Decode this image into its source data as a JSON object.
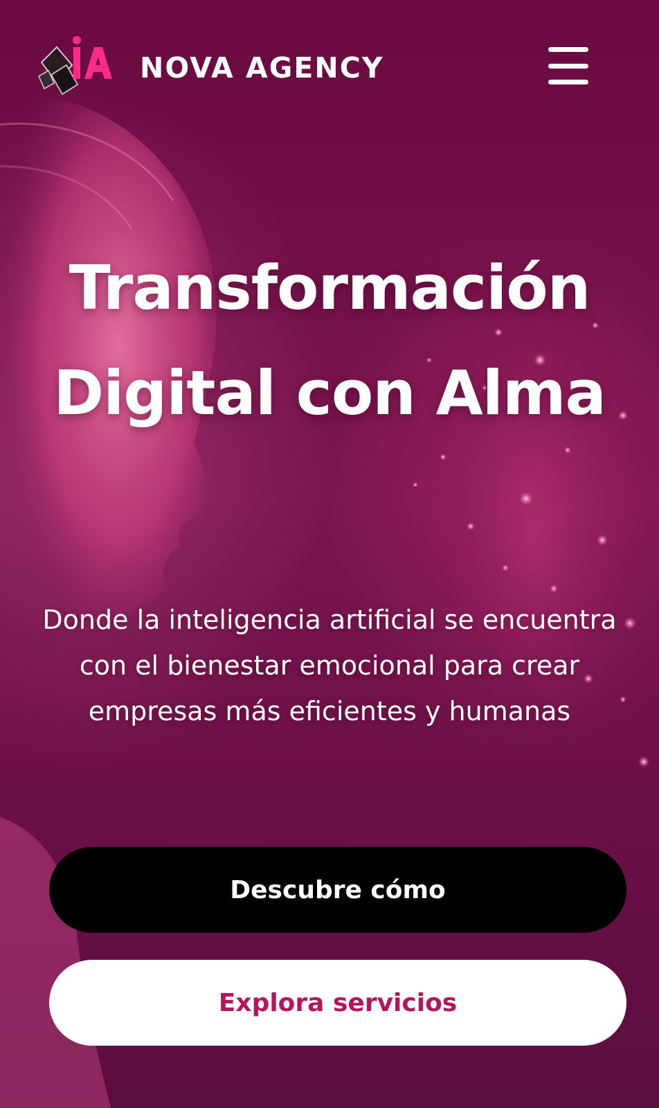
{
  "header": {
    "brand_name": "NOVA AGENCY",
    "logo_icon": "ia-logo-icon",
    "menu_icon": "hamburger-menu-icon"
  },
  "hero": {
    "title": "Transformación Digital con Alma",
    "subtitle": "Donde la inteligencia artificial se encuentra con el bienestar emocional para crear empresas más eficientes y humanas",
    "background": "robot-face-and-sparkle-heart-image"
  },
  "actions": {
    "primary_label": "Descubre cómo",
    "secondary_label": "Explora servicios"
  },
  "colors": {
    "background": "#6e0c44",
    "accent": "#b3155e",
    "logo_pink": "#ff2a8a",
    "primary_button": "#000000",
    "secondary_button": "#ffffff"
  }
}
